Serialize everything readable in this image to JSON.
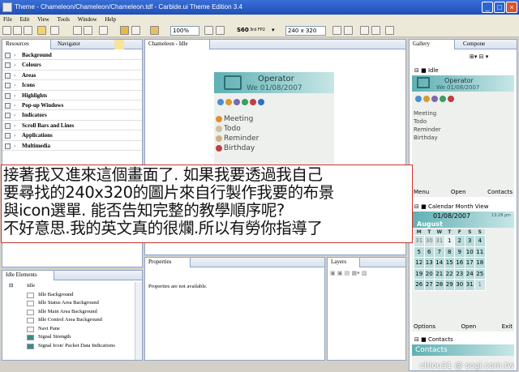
{
  "window": {
    "title": "Theme - Chameleon/Chameleon/Chameleon.tdf - Carbide.ui Theme Edition 3.4"
  },
  "menu": [
    "File",
    "Edit",
    "View",
    "Tools",
    "Window",
    "Help"
  ],
  "toolbar": {
    "zoom": "100%",
    "resolution": "240 x 320",
    "s60_label": "S60",
    "s60_sub": "3rd FP2"
  },
  "left_panel": {
    "tabs": [
      "Resources",
      "Navigator"
    ],
    "items": [
      "Background",
      "Colours",
      "Areas",
      "Icons",
      "Highlights",
      "Pop-up Windows",
      "Indicators",
      "Scroll Bars and Lines",
      "Applications",
      "Multimedia"
    ]
  },
  "editor": {
    "tab": "Chameleon - Idle"
  },
  "phone_main": {
    "operator": "Operator",
    "date": "We 01/08/2007",
    "items": [
      "Meeting",
      "Todo",
      "Reminder",
      "Birthday"
    ]
  },
  "gallery": {
    "tabs": [
      "Gallery",
      "Compone"
    ],
    "idle_label": "Idle",
    "operator": "Operator",
    "date": "We 01/08/2007",
    "items": [
      "Meeting",
      "Todo",
      "Reminder",
      "Birthday"
    ],
    "softkeys": [
      "Menu",
      "Open",
      "Contacts"
    ],
    "calendar_label": "Calendar Month View",
    "cal_date": "01/08/2007",
    "cal_time": "13:28 pm",
    "cal_month": "August",
    "cal_days": [
      "M",
      "T",
      "W",
      "T",
      "F",
      "S",
      "S"
    ],
    "cal_weeks": [
      [
        "31",
        "30",
        "31",
        "1",
        "2",
        "3",
        "4"
      ],
      [
        "5",
        "6",
        "7",
        "8",
        "9",
        "10",
        "11"
      ],
      [
        "12",
        "13",
        "14",
        "15",
        "16",
        "17",
        "18"
      ],
      [
        "19",
        "20",
        "21",
        "22",
        "23",
        "24",
        "25"
      ],
      [
        "26",
        "27",
        "28",
        "29",
        "30",
        "31",
        "1"
      ]
    ],
    "cal_softkeys": [
      "Options",
      "Open",
      "Exit"
    ],
    "contacts_label": "Contacts",
    "contacts_title": "Contacts"
  },
  "idle_elements": {
    "title": "Idle Elements",
    "root": "Idle",
    "items": [
      "Idle Background",
      "Idle Status Area Background",
      "Idle Main Area Background",
      "Idle Control Area Background",
      "Navi Pane",
      "Signal Strength",
      "Signal Icon/ Packet Data Indications"
    ]
  },
  "properties": {
    "title": "Properties",
    "message": "Properties are not available."
  },
  "layers": {
    "title": "Layers"
  },
  "overlay_text": [
    "接著我又進來這個畫面了. 如果我要透過我自己",
    "要尋找的240x320的圖片來自行製作我要的布景",
    "與icon選單. 能否告知完整的教學順序呢?",
    "不好意思.我的英文真的很爛.所以有勞你指導了"
  ],
  "watermark": "chiou31    @ sogi.com.tw"
}
